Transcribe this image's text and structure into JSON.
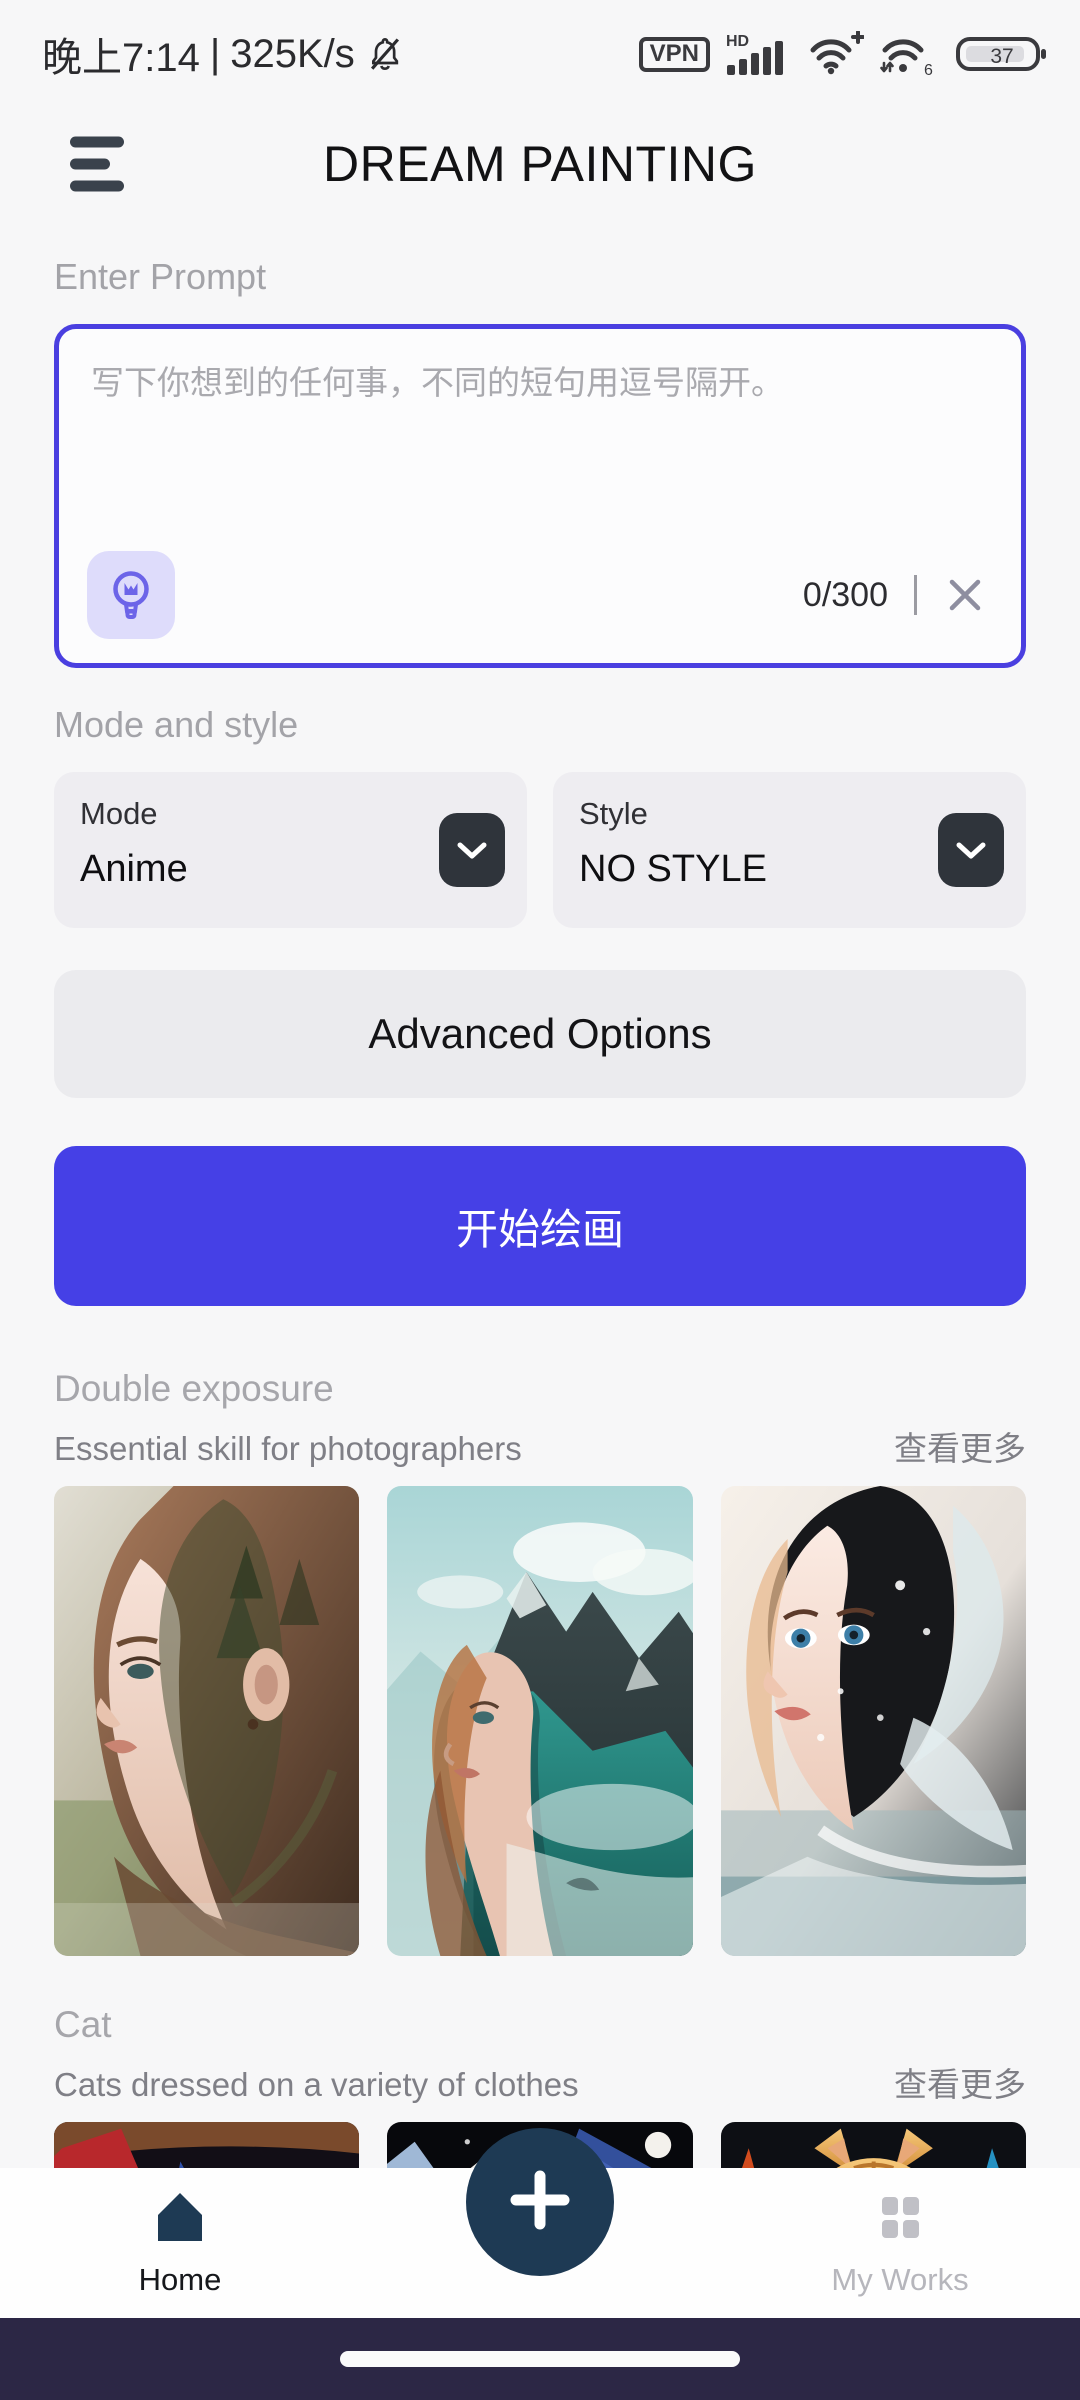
{
  "status_bar": {
    "time": "晚上7:14",
    "separator": "|",
    "network_speed": "325K/s",
    "icons": [
      "bell-muted-icon",
      "vpn-icon",
      "hd-signal-icon",
      "wifi-plus-icon",
      "wifi-6-icon",
      "battery-icon"
    ],
    "vpn_label": "VPN",
    "hd_label": "HD",
    "wifi6_label": "6",
    "battery_level": "37"
  },
  "app_bar": {
    "menu_icon": "hamburger-menu-icon",
    "title": "DREAM PAINTING"
  },
  "prompt": {
    "label": "Enter Prompt",
    "placeholder": "写下你想到的任何事，不同的短句用逗号隔开。",
    "value": "",
    "idea_icon": "lightbulb-idea-icon",
    "counter": "0/300",
    "divider": "|",
    "clear_icon": "close-x-icon"
  },
  "mode_style": {
    "label": "Mode and style",
    "mode": {
      "title": "Mode",
      "value": "Anime",
      "chevron": "chevron-down-icon"
    },
    "style": {
      "title": "Style",
      "value": "NO STYLE",
      "chevron": "chevron-down-icon"
    }
  },
  "advanced_options_label": "Advanced Options",
  "start_button_label": "开始绘画",
  "galleries": [
    {
      "title": "Double exposure",
      "subtitle": "Essential skill for photographers",
      "more_label": "查看更多",
      "items": [
        {
          "alt": "double-exposure-forest-portrait"
        },
        {
          "alt": "double-exposure-mountain-portrait"
        },
        {
          "alt": "double-exposure-water-portrait"
        }
      ]
    },
    {
      "title": "Cat",
      "subtitle": "Cats dressed on a variety of clothes",
      "more_label": "查看更多",
      "items": [
        {
          "alt": "cat-red-blue-costume"
        },
        {
          "alt": "cat-wizard-hats"
        },
        {
          "alt": "cat-fire-ice-tabby"
        }
      ]
    }
  ],
  "bottom_nav": {
    "home": {
      "label": "Home",
      "icon": "home-icon",
      "active": true
    },
    "create": {
      "label": "",
      "icon": "plus-icon"
    },
    "my_works": {
      "label": "My Works",
      "icon": "grid-icon",
      "active": false
    }
  },
  "colors": {
    "accent_purple": "#4540E6",
    "border_purple": "#4A3FE0",
    "idea_chip_bg": "#DEDCFB",
    "chevron_dark": "#2F343B",
    "fab_navy": "#1E3A54",
    "gesture_bar": "#2C2745",
    "page_bg": "#F7F7F8"
  }
}
